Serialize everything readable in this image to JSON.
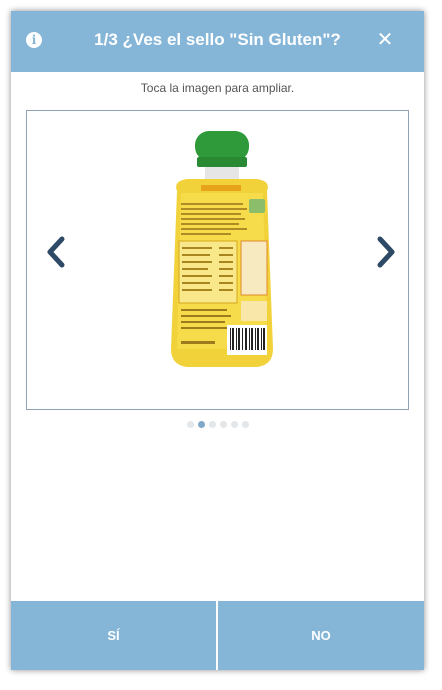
{
  "header": {
    "title": "1/3 ¿Ves el sello \"Sin Gluten\"?",
    "info_icon": "info-icon",
    "close_icon": "close-icon"
  },
  "hint": "Toca la imagen para ampliar.",
  "carousel": {
    "prev_icon": "chevron-left-icon",
    "next_icon": "chevron-right-icon",
    "dot_count": 6,
    "active_index": 1,
    "image_description": "product-photo"
  },
  "buttons": {
    "yes": "SÍ",
    "no": "NO"
  },
  "colors": {
    "accent": "#85b6d8",
    "arrow": "#2e4a66",
    "dot_active": "#7fa8c9"
  }
}
